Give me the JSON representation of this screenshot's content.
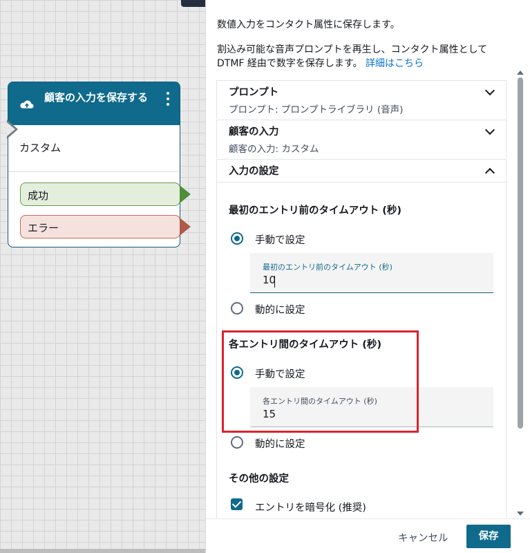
{
  "block": {
    "title": "顧客の入力を保存する",
    "subtitle": "カスタム",
    "branches": [
      "成功",
      "エラー"
    ]
  },
  "panel": {
    "intro1": "数値入力をコンタクト属性に保存します。",
    "intro2": "割込み可能な音声プロンプトを再生し、コンタクト属性として DTMF 経由で数字を保存します。",
    "learn_more": "詳細はこちら",
    "sections": [
      {
        "title": "プロンプト",
        "desc": "プロンプト: プロンプトライブラリ (音声)"
      },
      {
        "title": "顧客の入力",
        "desc": "顧客の入力: カスタム"
      },
      {
        "title": "入力の設定",
        "desc": ""
      }
    ],
    "first_timeout": {
      "title": "最初のエントリ前のタイムアウト (秒)",
      "manual": "手動で設定",
      "field_label": "最初のエントリ前のタイムアウト (秒)",
      "value": "10",
      "dynamic": "動的に設定"
    },
    "between_timeout": {
      "title": "各エントリ間のタイムアウト (秒)",
      "manual": "手動で設定",
      "field_label": "各エントリ間のタイムアウト (秒)",
      "value": "15",
      "dynamic": "動的に設定"
    },
    "other": {
      "title": "その他の設定",
      "encrypt": "エントリを暗号化 (推奨)"
    },
    "footer": {
      "cancel": "キャンセル",
      "save": "保存"
    }
  }
}
